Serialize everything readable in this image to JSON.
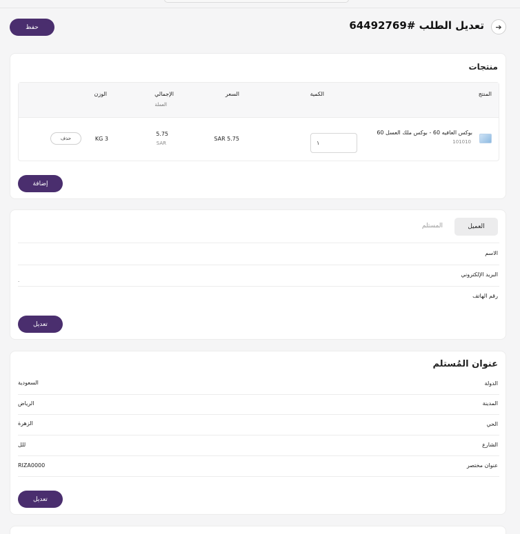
{
  "header": {
    "title": "تعديل الطلب #64492769",
    "save_label": "حفظ",
    "back_icon": "arrow-right-icon"
  },
  "products": {
    "title": "منتجات",
    "columns": {
      "product": "المنتج",
      "quantity": "الكمية",
      "price": "السعر",
      "total": "الإجمالي",
      "total_sub": "العملة",
      "weight": "الوزن"
    },
    "rows": [
      {
        "name": "بوكس العافيه 60 - بوكس ملك العسل 60",
        "sku": "101010",
        "quantity": "١",
        "price": "SAR 5.75",
        "total": "5.75",
        "currency": "SAR",
        "weight": "KG 3",
        "delete_label": "حذف"
      }
    ],
    "add_label": "إضافة"
  },
  "customer": {
    "tabs": [
      "العميل",
      "المستلم"
    ],
    "fields": [
      "الاسم",
      "البريد الإلكتروني",
      "رقم الهاتف"
    ],
    "email_value": ".",
    "edit_label": "تعديل"
  },
  "address": {
    "title": "عنوان المُستلم",
    "rows": [
      {
        "label": "الدولة",
        "value": "السعودية"
      },
      {
        "label": "المدينة",
        "value": "الرياض"
      },
      {
        "label": "الحي",
        "value": "الزهرة"
      },
      {
        "label": "الشارع",
        "value": "للل"
      },
      {
        "label": "عنوان مختصر",
        "value": "RIZA0000"
      }
    ],
    "edit_label": "تعديل"
  },
  "colors": {
    "primary": "#4a2e6e",
    "background": "#f5f5f6"
  }
}
